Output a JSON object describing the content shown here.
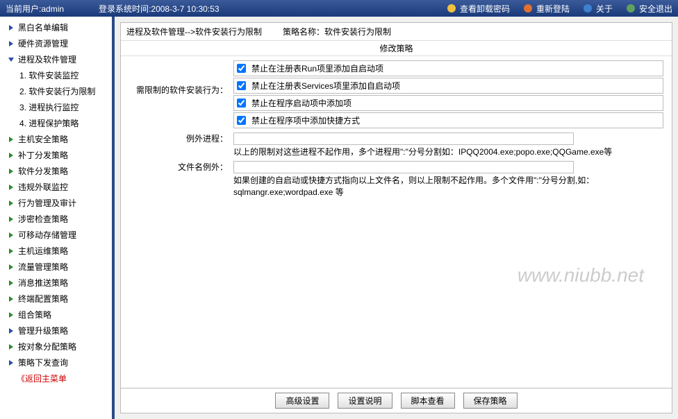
{
  "topbar": {
    "user_label": "当前用户",
    "user_value": "admin",
    "login_label": "登录系统时间",
    "login_value": "2008-3-7 10:30:53",
    "items": [
      {
        "icon": "key-icon",
        "label": "查看卸载密码"
      },
      {
        "icon": "users-icon",
        "label": "重新登陆"
      },
      {
        "icon": "info-icon",
        "label": "关于"
      },
      {
        "icon": "exit-icon",
        "label": "安全退出"
      }
    ]
  },
  "sidebar": {
    "items": [
      {
        "type": "node",
        "label": "黑白名单编辑"
      },
      {
        "type": "node",
        "label": "硬件资源管理"
      },
      {
        "type": "node",
        "label": "进程及软件管理",
        "open": true,
        "children": [
          {
            "num": "1.",
            "label": "软件安装监控"
          },
          {
            "num": "2.",
            "label": "软件安装行为限制"
          },
          {
            "num": "3.",
            "label": "进程执行监控"
          },
          {
            "num": "4.",
            "label": "进程保护策略"
          }
        ]
      },
      {
        "type": "leaf",
        "label": "主机安全策略"
      },
      {
        "type": "leaf",
        "label": "补丁分发策略"
      },
      {
        "type": "leaf",
        "label": "软件分发策略"
      },
      {
        "type": "leaf",
        "label": "违规外联监控"
      },
      {
        "type": "leaf",
        "label": "行为管理及审计"
      },
      {
        "type": "leaf",
        "label": "涉密检查策略"
      },
      {
        "type": "leaf",
        "label": "可移动存储管理"
      },
      {
        "type": "leaf",
        "label": "主机运维策略"
      },
      {
        "type": "leaf",
        "label": "流量管理策略"
      },
      {
        "type": "leaf",
        "label": "消息推送策略"
      },
      {
        "type": "leaf",
        "label": "终端配置策略"
      },
      {
        "type": "leaf",
        "label": "组合策略"
      },
      {
        "type": "node",
        "label": "管理升级策略"
      },
      {
        "type": "leaf",
        "label": "按对象分配策略"
      },
      {
        "type": "node",
        "label": "策略下发查询"
      }
    ],
    "return": "《返回主菜单"
  },
  "panel": {
    "breadcrumb": "进程及软件管理-->软件安装行为限制",
    "policy_label": "策略名称：",
    "policy_value": "软件安装行为限制",
    "title": "修改策略",
    "row_label": "需限制的软件安装行为：",
    "checks": [
      {
        "label": "禁止在注册表Run项里添加自启动项",
        "checked": true
      },
      {
        "label": "禁止在注册表Services项里添加自启动项",
        "checked": true
      },
      {
        "label": "禁止在程序启动项中添加项",
        "checked": true
      },
      {
        "label": "禁止在程序项中添加快捷方式",
        "checked": true
      }
    ],
    "except_proc_label": "例外进程：",
    "except_proc_value": "",
    "except_proc_hint": "以上的限制对这些进程不起作用，多个进程用\":\"分号分割如：IPQQ2004.exe;popo.exe;QQGame.exe等",
    "except_file_label": "文件名例外：",
    "except_file_value": "",
    "except_file_hint": "如果创建的自启动或快捷方式指向以上文件名，则以上限制不起作用。多个文件用\":\"分号分割,如：sqlmangr.exe;wordpad.exe 等",
    "watermark": "www.niubb.net",
    "buttons": [
      "高级设置",
      "设置说明",
      "脚本查看",
      "保存策略"
    ]
  }
}
